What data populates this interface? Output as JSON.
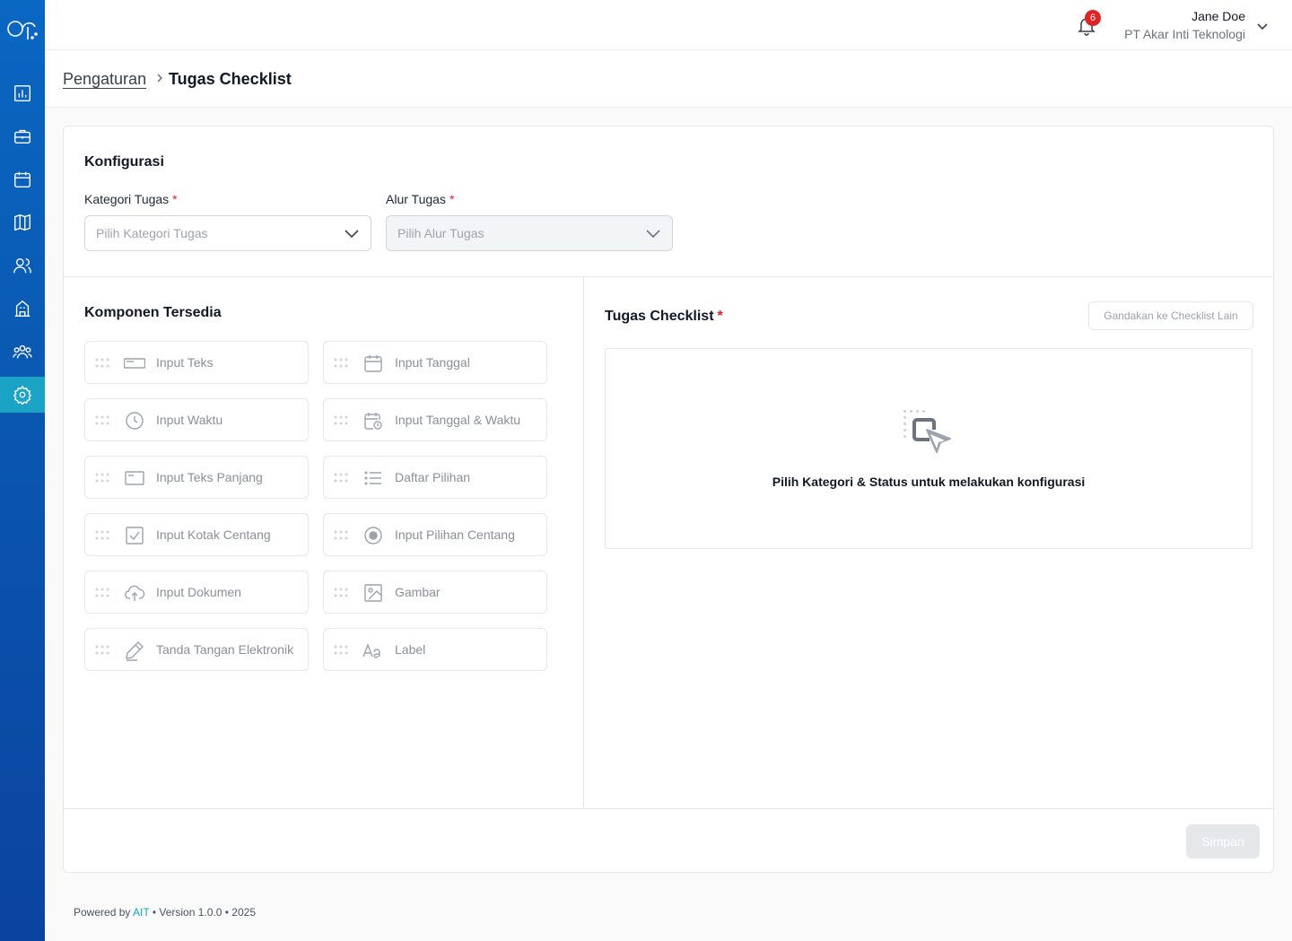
{
  "header": {
    "notification_count": "6",
    "user_name": "Jane Doe",
    "user_org": "PT Akar Inti Teknologi"
  },
  "breadcrumb": {
    "parent": "Pengaturan",
    "current": "Tugas Checklist"
  },
  "configuration": {
    "title": "Konfigurasi",
    "category_label": "Kategori Tugas",
    "category_placeholder": "Pilih Kategori Tugas",
    "flow_label": "Alur Tugas",
    "flow_placeholder": "Pilih Alur Tugas",
    "required_mark": "*"
  },
  "components": {
    "title": "Komponen Tersedia",
    "items": [
      {
        "label": "Input Teks",
        "icon": "text-input-icon"
      },
      {
        "label": "Input Tanggal",
        "icon": "calendar-icon"
      },
      {
        "label": "Input Waktu",
        "icon": "clock-icon"
      },
      {
        "label": "Input Tanggal & Waktu",
        "icon": "calendar-clock-icon"
      },
      {
        "label": "Input Teks Panjang",
        "icon": "textarea-icon"
      },
      {
        "label": "Daftar Pilihan",
        "icon": "list-icon"
      },
      {
        "label": "Input Kotak Centang",
        "icon": "checkbox-icon"
      },
      {
        "label": "Input Pilihan Centang",
        "icon": "radio-icon"
      },
      {
        "label": "Input Dokumen",
        "icon": "upload-icon"
      },
      {
        "label": "Gambar",
        "icon": "image-icon"
      },
      {
        "label": "Tanda Tangan Elektronik",
        "icon": "pen-icon"
      },
      {
        "label": "Label",
        "icon": "text-aa-icon"
      }
    ]
  },
  "checklist": {
    "title": "Tugas Checklist",
    "required_mark": "*",
    "duplicate_button": "Gandakan ke Checklist Lain",
    "empty_message": "Pilih Kategori & Status untuk melakukan konfigurasi"
  },
  "actions": {
    "save_label": "Simpan"
  },
  "footer": {
    "powered_by": "Powered by",
    "brand": "AIT",
    "version": "• Version 1.0.0 • 2025"
  },
  "colors": {
    "sidebar": "#0a57b0",
    "sidebar_active": "#1aa3c4",
    "required": "#e02424",
    "badge": "#e02424"
  }
}
